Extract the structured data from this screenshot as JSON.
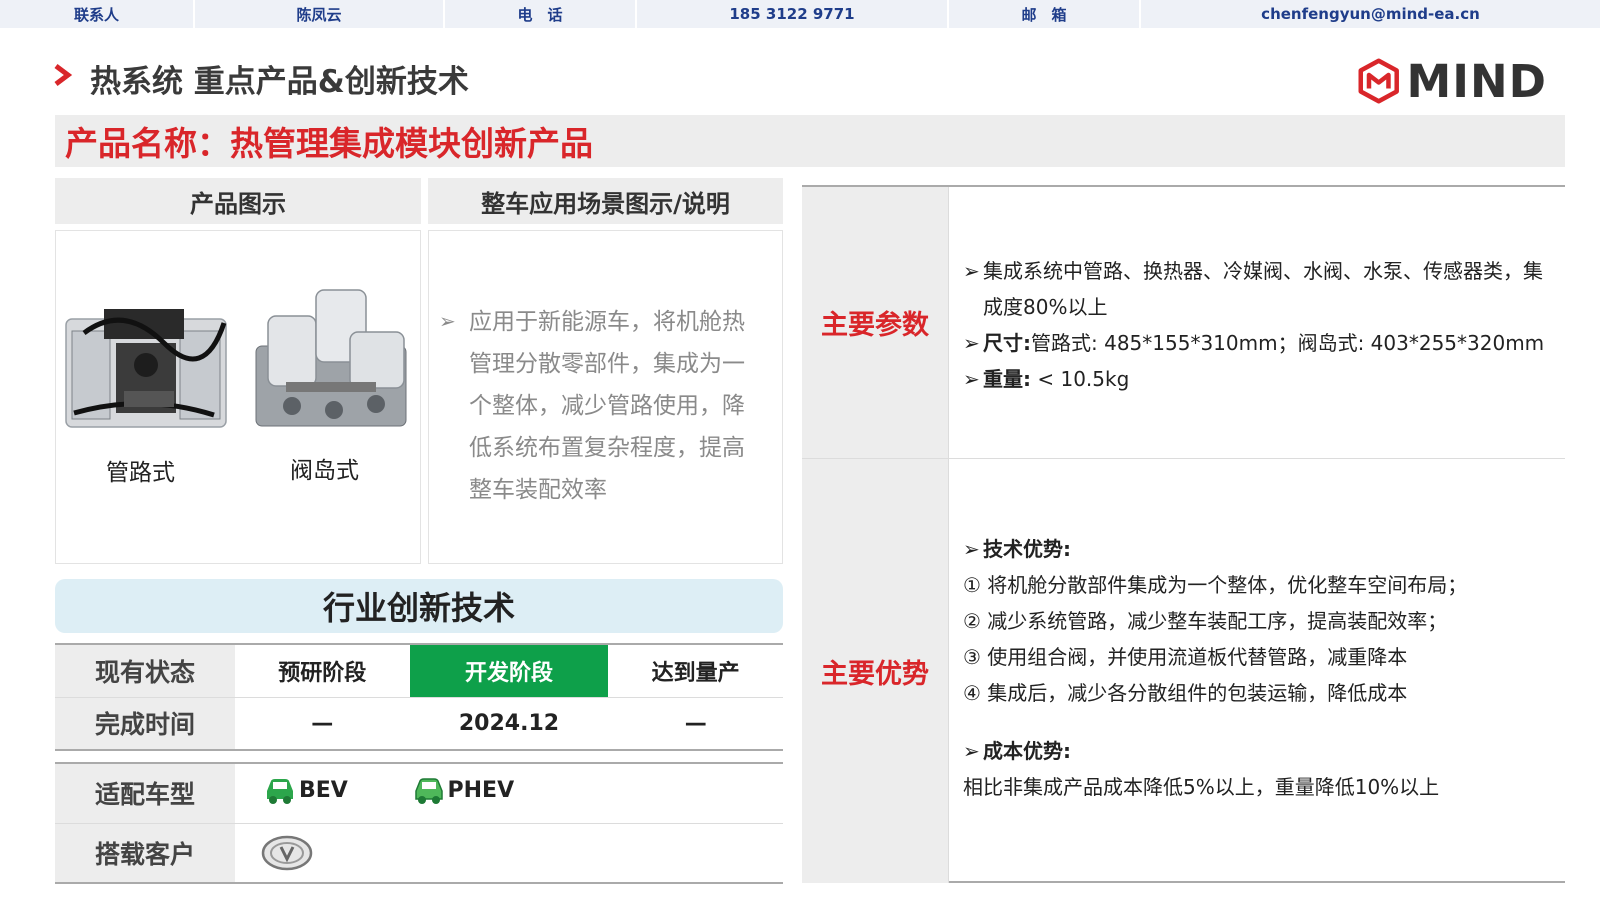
{
  "contact": {
    "label_contact": "联系人",
    "name": "陈凤云",
    "label_phone": "电　话",
    "phone": "185 3122 9771",
    "label_email": "邮　箱",
    "email": "chenfengyun@mind-ea.cn"
  },
  "header": {
    "title": "热系统 重点产品&创新技术",
    "logo_text": "MIND",
    "accent_color": "#d9262a"
  },
  "product_name": "产品名称：热管理集成模块创新产品",
  "product_images": {
    "header": "产品图示",
    "items": [
      {
        "label": "管路式"
      },
      {
        "label": "阀岛式"
      }
    ]
  },
  "scene": {
    "header": "整车应用场景图示/说明",
    "lines": [
      "应用于新能源车，将机舱热",
      "管理分散零部件，集成为一",
      "个整体，减少管路使用，降",
      "低系统布置复杂程度，提高",
      "整车装配效率"
    ]
  },
  "innovation": {
    "title": "行业创新技术",
    "status_label": "现有状态",
    "stages": [
      "预研阶段",
      "开发阶段",
      "达到量产"
    ],
    "active_stage": "开发阶段",
    "active_color": "#0ea04a",
    "time_label": "完成时间",
    "times": [
      "—",
      "2024.12",
      "—"
    ]
  },
  "fit": {
    "vehicle_label": "适配车型",
    "vehicles": [
      {
        "name": "BEV",
        "icon": "car-icon"
      },
      {
        "name": "PHEV",
        "icon": "car-icon"
      }
    ],
    "customer_label": "搭载客户",
    "customer_icon": "customer-logo-icon"
  },
  "params": {
    "header": "主要参数",
    "line1": "集成系统中管路、换热器、冷媒阀、水阀、水泵、传感器类，集",
    "line1b": "成度80%以上",
    "size_label": "尺寸:",
    "size_value": "管路式: 485*155*310mm；阀岛式: 403*255*320mm",
    "weight_label": "重量:",
    "weight_value": "< 10.5kg"
  },
  "advantages": {
    "header": "主要优势",
    "tech_label": "技术优势:",
    "tech_items": [
      "① 将机舱分散部件集成为一个整体，优化整车空间布局；",
      "② 减少系统管路，减少整车装配工序，提高装配效率；",
      "③ 使用组合阀，并使用流道板代替管路，减重降本",
      "④ 集成后，减少各分散组件的包装运输，降低成本"
    ],
    "cost_label": "成本优势:",
    "cost_text": "相比非集成产品成本降低5%以上，重量降低10%以上"
  }
}
